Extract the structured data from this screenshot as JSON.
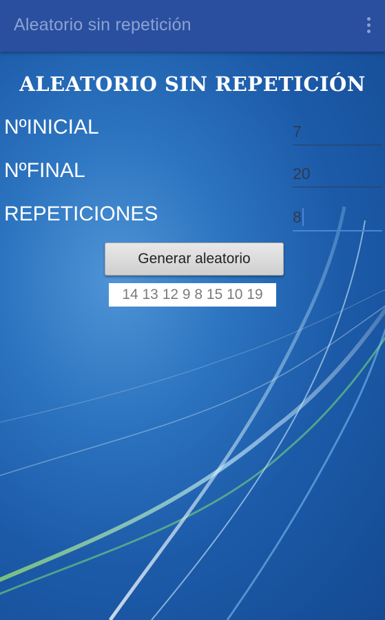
{
  "appbar": {
    "title": "Aleatorio sin repetición",
    "menu_icon": "overflow-menu-icon"
  },
  "main": {
    "heading": "ALEATORIO SIN REPETICIÓN",
    "fields": [
      {
        "label": "NºINICIAL",
        "value": "7"
      },
      {
        "label": "NºFINAL",
        "value": "20"
      },
      {
        "label": "REPETICIONES",
        "value": "8"
      }
    ],
    "button_label": "Generar aleatorio",
    "result": "14 13 12 9 8 15 10 19"
  },
  "colors": {
    "appbar": "#2a4f9f",
    "background": "#1c5aa8",
    "accent": "#4a86d6"
  }
}
